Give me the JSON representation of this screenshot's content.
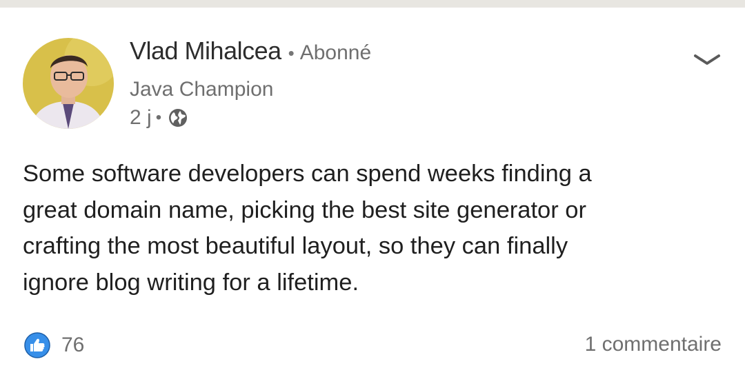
{
  "post": {
    "author": {
      "name": "Vlad Mihalcea",
      "follow_status": "Abonné",
      "headline": "Java Champion"
    },
    "meta": {
      "timestamp": "2 j",
      "visibility_icon": "globe-icon"
    },
    "menu_icon": "chevron-down-icon",
    "body_lines": [
      "Some software developers can spend weeks finding a",
      "great domain name, picking the best site generator or",
      "crafting the most beautiful layout, so they can finally",
      "ignore blog writing for a lifetime."
    ],
    "reactions": {
      "icon": "thumbs-up-icon",
      "count": "76"
    },
    "comments_label": "1 commentaire"
  },
  "colors": {
    "background": "#ffffff",
    "top_strip": "#e8e6e1",
    "text_primary": "#1f1f1f",
    "text_secondary": "#6f6f6f",
    "like_blue": "#378fe9"
  }
}
